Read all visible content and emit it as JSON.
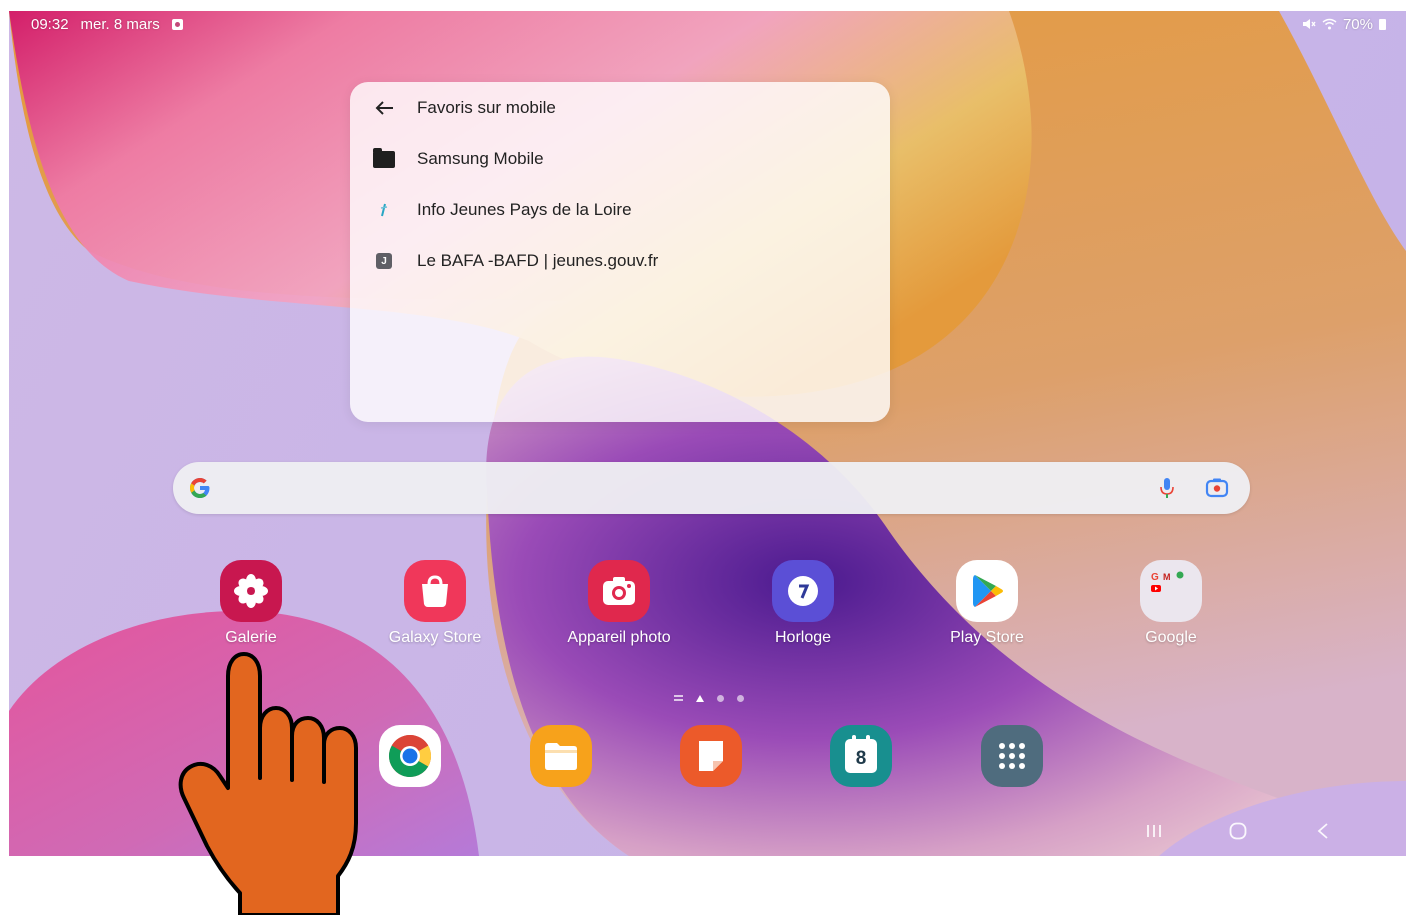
{
  "status_bar": {
    "time": "09:32",
    "date": "mer. 8 mars",
    "battery": "70%"
  },
  "bookmarks": {
    "header": "Favoris sur mobile",
    "items": [
      {
        "label": "Samsung Mobile",
        "icon": "folder-icon"
      },
      {
        "label": "Info Jeunes Pays de la Loire",
        "icon": "info-jeunes-favicon"
      },
      {
        "label": "Le BAFA -BAFD | jeunes.gouv.fr",
        "icon": "jeunes-gouv-favicon",
        "favicon_letter": "J"
      }
    ]
  },
  "search": {
    "icons": [
      "google-g-icon",
      "microphone-icon",
      "google-lens-icon"
    ]
  },
  "home_apps": [
    {
      "label": "Galerie",
      "icon": "gallery-flower-icon",
      "color": "#c8174f"
    },
    {
      "label": "Galaxy Store",
      "icon": "shopping-bag-icon",
      "color": "#f0375a"
    },
    {
      "label": "Appareil photo",
      "icon": "camera-icon",
      "color": "#e0284d"
    },
    {
      "label": "Horloge",
      "icon": "clock-icon",
      "color": "#5b4fd6"
    },
    {
      "label": "Play Store",
      "icon": "play-store-icon",
      "color": "#ffffff"
    },
    {
      "label": "Google",
      "icon": "google-folder-icon",
      "color": "#ebe6ee"
    }
  ],
  "dock": [
    {
      "name": "chrome",
      "icon": "chrome-icon"
    },
    {
      "name": "my-files",
      "icon": "folder-files-icon",
      "color": "#f7a21b"
    },
    {
      "name": "samsung-notes",
      "icon": "notes-icon",
      "color": "#ec5a2a"
    },
    {
      "name": "calendar",
      "icon": "calendar-icon",
      "color": "#188f8f",
      "day": "8"
    },
    {
      "name": "apps-drawer",
      "icon": "apps-grid-icon",
      "color": "#4f6c7e"
    }
  ],
  "page_indicator": {
    "pages": 3,
    "current": 1
  },
  "hand_color": "#e2661f"
}
